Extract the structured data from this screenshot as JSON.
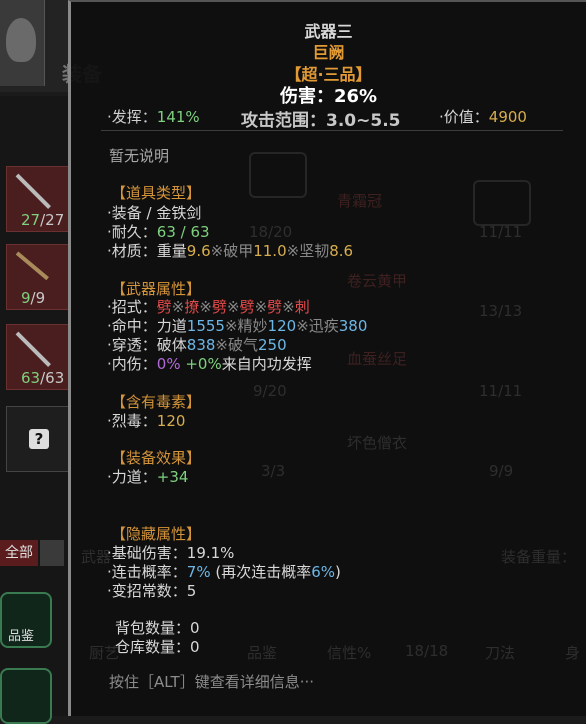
{
  "background": {
    "tab_label": "装备",
    "slot_counts": [
      {
        "cur": "27",
        "max": "27"
      },
      {
        "cur": "9",
        "max": "9"
      },
      {
        "cur": "63",
        "max": "63"
      }
    ],
    "all_button": "全部",
    "chest_label": "品鉴",
    "ghost_text": [
      "青霜冠",
      "18/20",
      "11/11",
      "卷云黄甲",
      "13/13",
      "血蚕丝足",
      "9/20",
      "11/11",
      "坏色僧衣",
      "3/3",
      "9/9",
      "武器",
      "装备重量：",
      "厨艺",
      "品鉴",
      "信性%",
      "18/18",
      "刀法",
      "身"
    ]
  },
  "tooltip": {
    "name": "武器三",
    "item": "巨阙",
    "grade": "【超·三品】",
    "damage_label": "伤害：",
    "damage_value": "26%",
    "exert_label": "·发挥：",
    "exert_value": "141%",
    "range_text": "攻击范围：3.0~5.5",
    "value_label": "·价值：",
    "value_value": "4900",
    "description": "暂无说明",
    "sections": {
      "type": {
        "title": "【道具类型】",
        "equip": "·装备 / 金铁剑",
        "dur_label": "·耐久：",
        "dur_value": "63 / 63",
        "mat_label": "·材质：重量",
        "mat_weight": "9.6",
        "mat_sep1": "※破甲",
        "mat_armor": "11.0",
        "mat_sep2": "※坚韧",
        "mat_tough": "8.6"
      },
      "weapon": {
        "title": "【武器属性】",
        "moves_label": "·招式：",
        "moves": [
          "劈",
          "撩",
          "劈",
          "劈",
          "劈",
          "刺"
        ],
        "moves_sep": "※",
        "hit_label": "·命中：力道",
        "hit_v1": "1555",
        "hit_s1": "※精妙",
        "hit_v2": "120",
        "hit_s2": "※迅疾",
        "hit_v3": "380",
        "pen_label": "·穿透：破体",
        "pen_v1": "838",
        "pen_s1": "※破气",
        "pen_v2": "250",
        "inner_label": "·内伤：",
        "inner_v1": "0%",
        "inner_v2": "+0%",
        "inner_rest": "来自内功发挥"
      },
      "poison": {
        "title": "【含有毒素】",
        "line_label": "·烈毒：",
        "line_value": "120"
      },
      "effect": {
        "title": "【装备效果】",
        "line_label": "·力道：",
        "line_value": "+34"
      },
      "hidden": {
        "title": "【隐藏属性】",
        "base_label": "·基础伤害：",
        "base_value": "19.1%",
        "combo_label": "·连击概率：",
        "combo_value": "7%",
        "combo_extra_a": "(再次连击概率",
        "combo_extra_v": "6%",
        "combo_extra_b": ")",
        "change_label": "·变招常数：",
        "change_value": "5"
      }
    },
    "bag_count": "背包数量：0",
    "store_count": "仓库数量：0",
    "footer": "按住［ALT］键查看详细信息···"
  },
  "colors": {
    "orange": "#e29a35",
    "green": "#7fd07f",
    "gold": "#d7ad4e",
    "red": "#e04a4a",
    "blue": "#6db7e6",
    "purple": "#b36ad8"
  }
}
